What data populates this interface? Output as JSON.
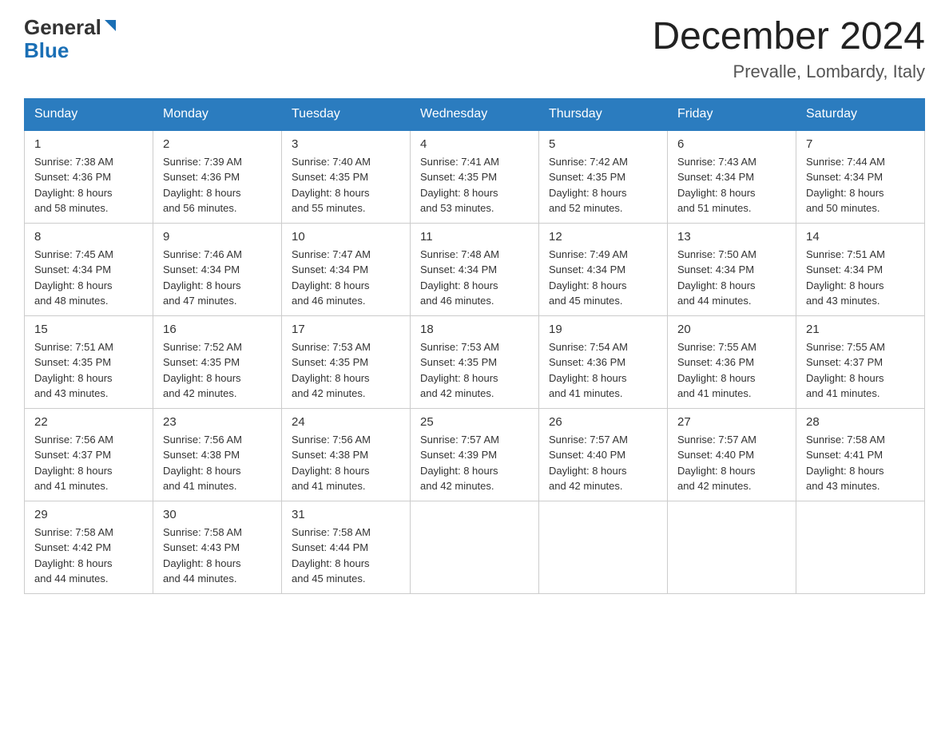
{
  "header": {
    "logo_general": "General",
    "logo_blue": "Blue",
    "month_title": "December 2024",
    "location": "Prevalle, Lombardy, Italy"
  },
  "weekdays": [
    "Sunday",
    "Monday",
    "Tuesday",
    "Wednesday",
    "Thursday",
    "Friday",
    "Saturday"
  ],
  "weeks": [
    [
      {
        "day": "1",
        "sunrise": "7:38 AM",
        "sunset": "4:36 PM",
        "daylight": "8 hours and 58 minutes."
      },
      {
        "day": "2",
        "sunrise": "7:39 AM",
        "sunset": "4:36 PM",
        "daylight": "8 hours and 56 minutes."
      },
      {
        "day": "3",
        "sunrise": "7:40 AM",
        "sunset": "4:35 PM",
        "daylight": "8 hours and 55 minutes."
      },
      {
        "day": "4",
        "sunrise": "7:41 AM",
        "sunset": "4:35 PM",
        "daylight": "8 hours and 53 minutes."
      },
      {
        "day": "5",
        "sunrise": "7:42 AM",
        "sunset": "4:35 PM",
        "daylight": "8 hours and 52 minutes."
      },
      {
        "day": "6",
        "sunrise": "7:43 AM",
        "sunset": "4:34 PM",
        "daylight": "8 hours and 51 minutes."
      },
      {
        "day": "7",
        "sunrise": "7:44 AM",
        "sunset": "4:34 PM",
        "daylight": "8 hours and 50 minutes."
      }
    ],
    [
      {
        "day": "8",
        "sunrise": "7:45 AM",
        "sunset": "4:34 PM",
        "daylight": "8 hours and 48 minutes."
      },
      {
        "day": "9",
        "sunrise": "7:46 AM",
        "sunset": "4:34 PM",
        "daylight": "8 hours and 47 minutes."
      },
      {
        "day": "10",
        "sunrise": "7:47 AM",
        "sunset": "4:34 PM",
        "daylight": "8 hours and 46 minutes."
      },
      {
        "day": "11",
        "sunrise": "7:48 AM",
        "sunset": "4:34 PM",
        "daylight": "8 hours and 46 minutes."
      },
      {
        "day": "12",
        "sunrise": "7:49 AM",
        "sunset": "4:34 PM",
        "daylight": "8 hours and 45 minutes."
      },
      {
        "day": "13",
        "sunrise": "7:50 AM",
        "sunset": "4:34 PM",
        "daylight": "8 hours and 44 minutes."
      },
      {
        "day": "14",
        "sunrise": "7:51 AM",
        "sunset": "4:34 PM",
        "daylight": "8 hours and 43 minutes."
      }
    ],
    [
      {
        "day": "15",
        "sunrise": "7:51 AM",
        "sunset": "4:35 PM",
        "daylight": "8 hours and 43 minutes."
      },
      {
        "day": "16",
        "sunrise": "7:52 AM",
        "sunset": "4:35 PM",
        "daylight": "8 hours and 42 minutes."
      },
      {
        "day": "17",
        "sunrise": "7:53 AM",
        "sunset": "4:35 PM",
        "daylight": "8 hours and 42 minutes."
      },
      {
        "day": "18",
        "sunrise": "7:53 AM",
        "sunset": "4:35 PM",
        "daylight": "8 hours and 42 minutes."
      },
      {
        "day": "19",
        "sunrise": "7:54 AM",
        "sunset": "4:36 PM",
        "daylight": "8 hours and 41 minutes."
      },
      {
        "day": "20",
        "sunrise": "7:55 AM",
        "sunset": "4:36 PM",
        "daylight": "8 hours and 41 minutes."
      },
      {
        "day": "21",
        "sunrise": "7:55 AM",
        "sunset": "4:37 PM",
        "daylight": "8 hours and 41 minutes."
      }
    ],
    [
      {
        "day": "22",
        "sunrise": "7:56 AM",
        "sunset": "4:37 PM",
        "daylight": "8 hours and 41 minutes."
      },
      {
        "day": "23",
        "sunrise": "7:56 AM",
        "sunset": "4:38 PM",
        "daylight": "8 hours and 41 minutes."
      },
      {
        "day": "24",
        "sunrise": "7:56 AM",
        "sunset": "4:38 PM",
        "daylight": "8 hours and 41 minutes."
      },
      {
        "day": "25",
        "sunrise": "7:57 AM",
        "sunset": "4:39 PM",
        "daylight": "8 hours and 42 minutes."
      },
      {
        "day": "26",
        "sunrise": "7:57 AM",
        "sunset": "4:40 PM",
        "daylight": "8 hours and 42 minutes."
      },
      {
        "day": "27",
        "sunrise": "7:57 AM",
        "sunset": "4:40 PM",
        "daylight": "8 hours and 42 minutes."
      },
      {
        "day": "28",
        "sunrise": "7:58 AM",
        "sunset": "4:41 PM",
        "daylight": "8 hours and 43 minutes."
      }
    ],
    [
      {
        "day": "29",
        "sunrise": "7:58 AM",
        "sunset": "4:42 PM",
        "daylight": "8 hours and 44 minutes."
      },
      {
        "day": "30",
        "sunrise": "7:58 AM",
        "sunset": "4:43 PM",
        "daylight": "8 hours and 44 minutes."
      },
      {
        "day": "31",
        "sunrise": "7:58 AM",
        "sunset": "4:44 PM",
        "daylight": "8 hours and 45 minutes."
      },
      null,
      null,
      null,
      null
    ]
  ],
  "labels": {
    "sunrise": "Sunrise: ",
    "sunset": "Sunset: ",
    "daylight": "Daylight: "
  }
}
